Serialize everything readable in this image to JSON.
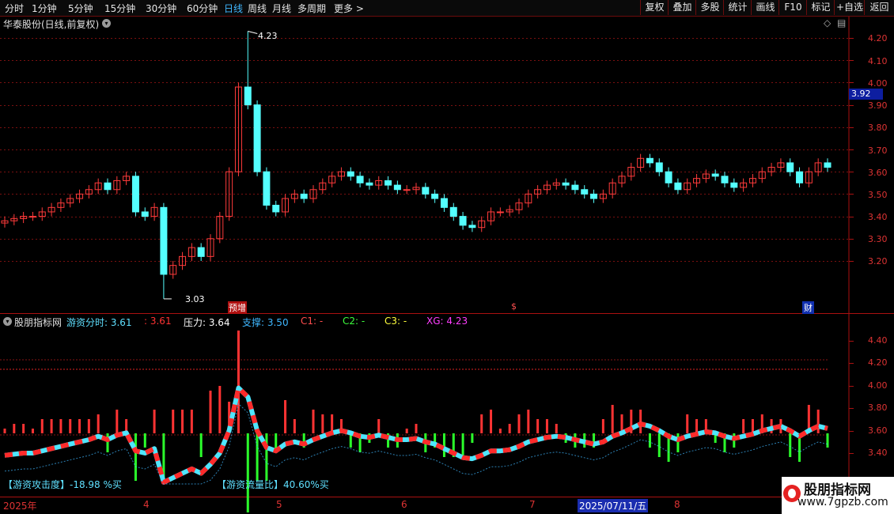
{
  "toolbar": {
    "periods": [
      "分时",
      "1分钟",
      "5分钟",
      "15分钟",
      "30分钟",
      "60分钟",
      "日线",
      "周线",
      "月线",
      "多周期",
      "更多 >"
    ],
    "active_period": "日线",
    "tools": [
      "复权",
      "叠加",
      "多股",
      "统计",
      "画线",
      "F10",
      "标记",
      "+自选",
      "返回"
    ]
  },
  "main_panel": {
    "title": "华泰股份(日线,前复权)",
    "price_ticks": [
      "4.20",
      "4.10",
      "4.00",
      "3.90",
      "3.80",
      "3.70",
      "3.60",
      "3.50",
      "3.40",
      "3.30",
      "3.20"
    ],
    "current_price": "3.92",
    "high_label": "4.23",
    "low_label": "3.03",
    "event_labels": [
      "预增",
      "$",
      "财"
    ]
  },
  "indicator_panel": {
    "name": "股朋指标网",
    "values": [
      {
        "label": "游资分时:",
        "value": "3.61",
        "color": "#5fe0ff"
      },
      {
        "label": ":",
        "value": "3.61",
        "color": "#ff3333"
      },
      {
        "label": "压力:",
        "value": "3.64",
        "color": "#ffffff"
      },
      {
        "label": "支撑:",
        "value": "3.50",
        "color": "#3fb7ff"
      },
      {
        "label": "C1:",
        "value": "-",
        "color": "#ff4d4d"
      },
      {
        "label": "C2:",
        "value": "-",
        "color": "#3dff3d"
      },
      {
        "label": "C3:",
        "value": "-",
        "color": "#ffff3d"
      },
      {
        "label": "XG:",
        "value": "4.23",
        "color": "#ff3dff"
      }
    ],
    "ticks": [
      "4.40",
      "4.20",
      "4.00",
      "3.80",
      "3.60",
      "3.40"
    ],
    "attack_label": "【游资攻击度】-18.98 %买",
    "flow_label": "【游资流量比】40.60%买"
  },
  "time_axis": {
    "labels": [
      "2025年",
      "4",
      "5",
      "6",
      "7",
      "2025/07/11/五",
      "8"
    ]
  },
  "watermark": {
    "title": "股朋指标网",
    "url": "www.7gpzb.com"
  },
  "chart_data": {
    "type": "candlestick",
    "title": "华泰股份(日线,前复权)",
    "ylim": [
      3.03,
      4.23
    ],
    "high": 4.23,
    "low": 3.03,
    "last_close": 3.62,
    "crosshair_price": 3.92,
    "approx_closes": [
      3.38,
      3.39,
      3.4,
      3.4,
      3.42,
      3.44,
      3.46,
      3.48,
      3.5,
      3.52,
      3.55,
      3.52,
      3.56,
      3.58,
      3.42,
      3.4,
      3.44,
      3.14,
      3.18,
      3.22,
      3.26,
      3.22,
      3.3,
      3.4,
      3.6,
      3.98,
      3.9,
      3.6,
      3.45,
      3.42,
      3.48,
      3.5,
      3.48,
      3.52,
      3.55,
      3.58,
      3.6,
      3.58,
      3.55,
      3.54,
      3.56,
      3.54,
      3.52,
      3.52,
      3.53,
      3.5,
      3.48,
      3.44,
      3.4,
      3.36,
      3.35,
      3.38,
      3.42,
      3.42,
      3.43,
      3.46,
      3.5,
      3.52,
      3.54,
      3.55,
      3.54,
      3.52,
      3.5,
      3.48,
      3.5,
      3.55,
      3.58,
      3.62,
      3.66,
      3.64,
      3.6,
      3.55,
      3.52,
      3.55,
      3.57,
      3.59,
      3.58,
      3.55,
      3.53,
      3.55,
      3.57,
      3.6,
      3.62,
      3.64,
      3.6,
      3.55,
      3.6,
      3.64,
      3.62
    ]
  }
}
